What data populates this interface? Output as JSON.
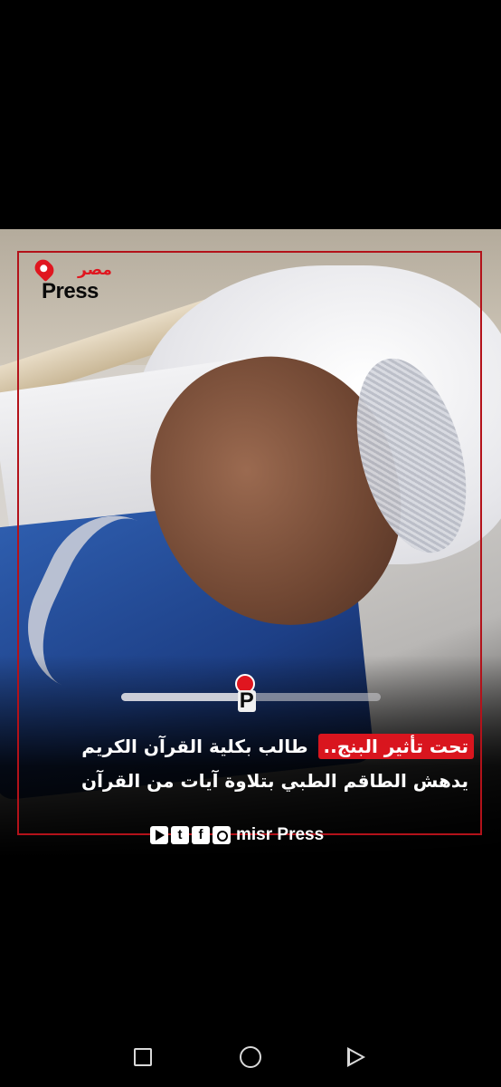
{
  "post": {
    "logo": {
      "arabic": "مصر",
      "latin": "Press"
    },
    "video": {
      "progress_percent": 48
    },
    "headline": {
      "highlight": "تحت تأثير البنج..",
      "line1_rest": "طالب بكلية القرآن الكريم",
      "line2": "يدهش الطاقم الطبي بتلاوة آيات من القرآن"
    },
    "social_bar": {
      "icons": [
        "youtube-icon",
        "twitter-icon",
        "facebook-icon",
        "instagram-icon"
      ],
      "brand": "misr Press"
    },
    "colors": {
      "accent": "#d9151e",
      "frame": "#b3121a"
    }
  },
  "system_nav": {
    "icons": [
      "recents-icon",
      "home-icon",
      "back-icon"
    ]
  }
}
